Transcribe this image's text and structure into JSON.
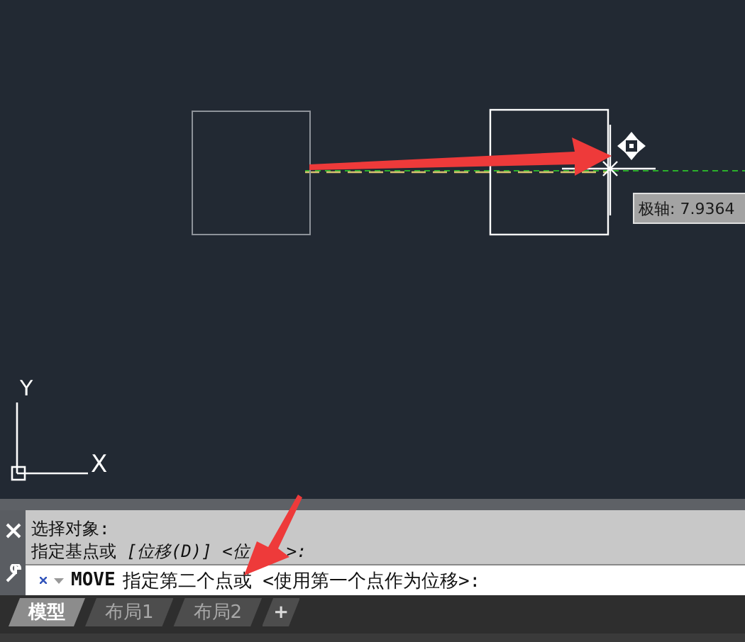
{
  "drawing": {
    "tooltip": "极轴: 7.9364",
    "ucs": {
      "y_label": "Y",
      "x_label": "X"
    }
  },
  "command": {
    "history": [
      {
        "text": "选择对象:"
      },
      {
        "text": "指定基点或 *[位移(D)] <位*",
        "tail": "*>:*"
      }
    ],
    "prompt": {
      "command": "MOVE",
      "text": "指定第二个点或 <使用第一个点作为位移>:"
    }
  },
  "tabs": [
    {
      "label": "模型",
      "selected": true
    },
    {
      "label": "布局1",
      "selected": false
    },
    {
      "label": "布局2",
      "selected": false
    }
  ],
  "add_tab": "+"
}
